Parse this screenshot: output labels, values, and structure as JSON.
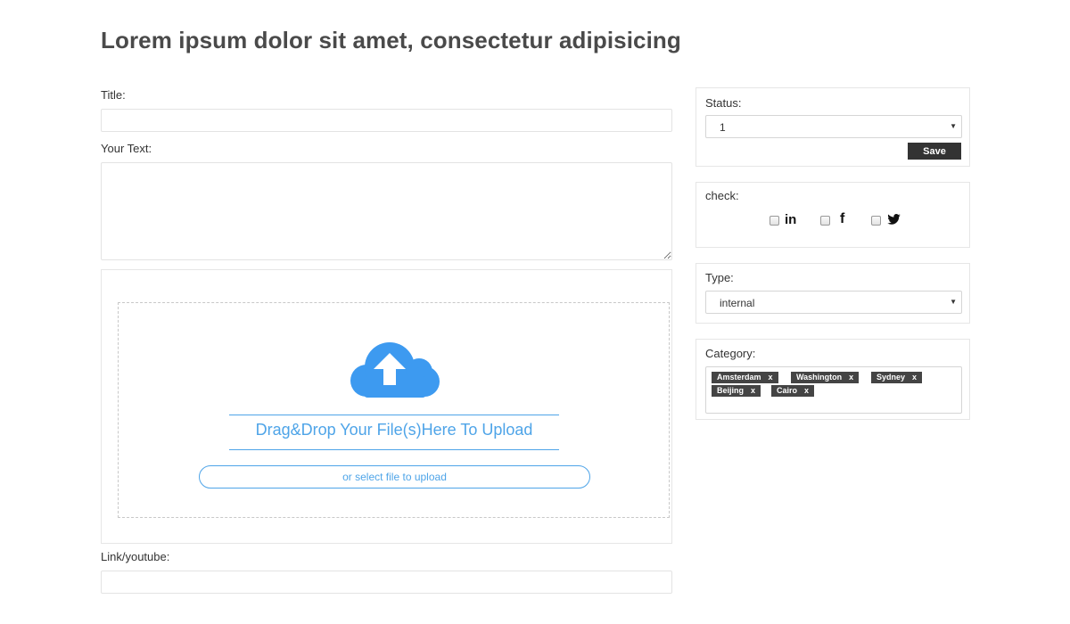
{
  "page": {
    "title": "Lorem ipsum dolor sit amet, consectetur adipisicing"
  },
  "form": {
    "title_label": "Title:",
    "title_value": "",
    "text_label": "Your Text:",
    "text_value": "",
    "link_label": "Link/youtube:",
    "link_value": ""
  },
  "upload": {
    "drop_text": "Drag&Drop Your File(s)Here To Upload",
    "select_label": "or select file to upload",
    "icon": "cloud-upload-icon",
    "accent_color": "#4ea4e8"
  },
  "status_panel": {
    "label": "Status:",
    "selected": "1",
    "save_label": "Save"
  },
  "check_panel": {
    "label": "check:",
    "options": [
      {
        "icon": "linkedin-icon",
        "glyph": "in",
        "checked": false
      },
      {
        "icon": "facebook-icon",
        "glyph": "f",
        "checked": false
      },
      {
        "icon": "twitter-icon",
        "glyph": "twitter-bird",
        "checked": false
      }
    ]
  },
  "type_panel": {
    "label": "Type:",
    "selected": "internal"
  },
  "category_panel": {
    "label": "Category:",
    "tags": [
      {
        "label": "Amsterdam",
        "remove": "x"
      },
      {
        "label": "Washington",
        "remove": "x"
      },
      {
        "label": "Sydney",
        "remove": "x"
      },
      {
        "label": "Beijing",
        "remove": "x"
      },
      {
        "label": "Cairo",
        "remove": "x"
      }
    ]
  }
}
